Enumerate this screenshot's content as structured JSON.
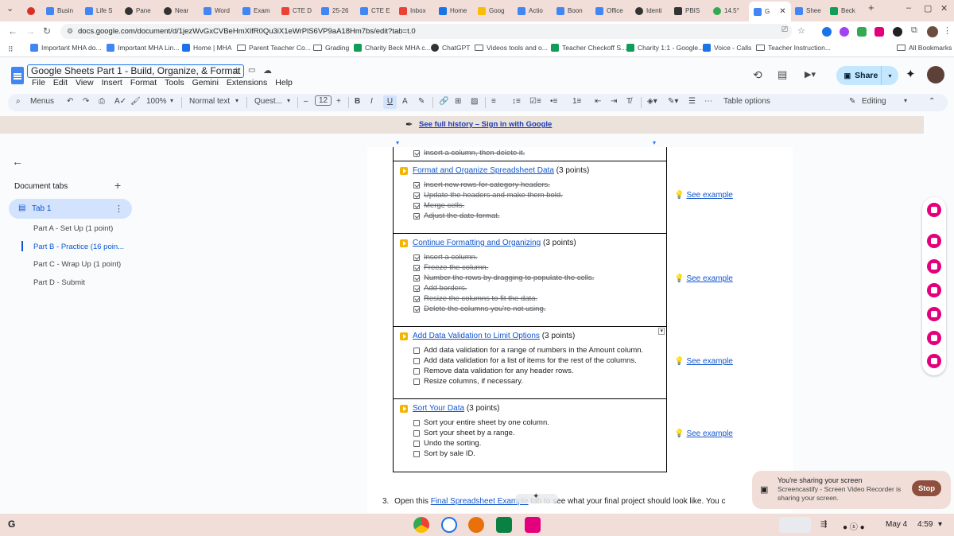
{
  "browser": {
    "tabs": [
      "Busin",
      "Life S",
      "Pane",
      "Near",
      "Word",
      "Exam",
      "CTE D",
      "25-26",
      "CTE E",
      "Inbox",
      "Home",
      "Goog",
      "Actio",
      "Boon",
      "Office",
      "Identi",
      "PBIS",
      "14.5°",
      "G",
      "Shee",
      "Beck"
    ],
    "active_tab": "G",
    "url": "docs.google.com/document/d/1jezWvGxCVBeHmXlfR0Qu3iX1eWrPlS6VP9aA18Hm7bs/edit?tab=t.0",
    "bookmarks": [
      "Important MHA do...",
      "Important MHA Lin...",
      "Home | MHA",
      "Parent Teacher Co...",
      "Grading",
      "Charity Beck MHA c...",
      "ChatGPT",
      "Videos tools and o...",
      "Teacher Checkoff S...",
      "Charity 1:1 - Google...",
      "Voice - Calls",
      "Teacher Instruction..."
    ],
    "all_bookmarks": "All Bookmarks"
  },
  "doc": {
    "title": "Google Sheets Part 1 - Build, Organize, & Format",
    "menu": [
      "File",
      "Edit",
      "View",
      "Insert",
      "Format",
      "Tools",
      "Gemini",
      "Extensions",
      "Help"
    ],
    "share": "Share"
  },
  "toolbar": {
    "menus": "Menus",
    "zoom": "100%",
    "style": "Normal text",
    "font": "Quest...",
    "size": "12",
    "table_options": "Table options",
    "mode": "Editing"
  },
  "banner": "See full history – Sign in with Google",
  "sidebar": {
    "heading": "Document tabs",
    "tab": "Tab 1",
    "outline": [
      "Part A - Set Up (1 point)",
      "Part B - Practice (16 poin...",
      "Part C - Wrap Up (1 point)",
      "Part D - Submit"
    ]
  },
  "tasks": {
    "top_item": "Insert a column, then delete it.",
    "sections": [
      {
        "title": "Format and Organize Spreadsheet Data",
        "points": "(3 points)",
        "items": [
          "Insert new rows for category headers.",
          "Update the headers and make them bold.",
          "Merge cells.",
          "Adjust the date format."
        ],
        "done": true
      },
      {
        "title": "Continue Formatting and Organizing",
        "points": "(3 points)",
        "items": [
          "Insert a column.",
          "Freeze the column.",
          "Number the rows by dragging to populate the cells.",
          "Add borders.",
          "Resize the columns to fit the data.",
          "Delete the columns you're not using."
        ],
        "done": true
      },
      {
        "title": "Add Data Validation to Limit Options",
        "points": "(3 points)",
        "items": [
          "Add data validation for a range of numbers in the Amount column.",
          "Add data validation for a list of items for the rest of the columns.",
          "Remove data validation for any header rows.",
          "Resize columns, if necessary."
        ],
        "done": false
      },
      {
        "title": "Sort Your Data",
        "points": "(3 points)",
        "items": [
          "Sort your entire sheet by one column.",
          "Sort your sheet by a range.",
          "Undo the sorting.",
          "Sort by sale ID."
        ],
        "done": false
      }
    ],
    "example_label": "See example"
  },
  "footer_line": {
    "number": "3.",
    "before": "Open this",
    "link": "Final Spreadsheet Example",
    "after": "tab to see what your final project should look like. You c"
  },
  "toast": {
    "title": "You're sharing your screen",
    "body": "Screencastify - Screen Video Recorder is sharing your screen.",
    "stop": "Stop"
  },
  "shelf": {
    "date": "May 4",
    "time": "4:59"
  },
  "colors": {
    "accent_link": "#1155cc",
    "share_bg": "#c2e7ff",
    "frame": "#f2ded9"
  }
}
